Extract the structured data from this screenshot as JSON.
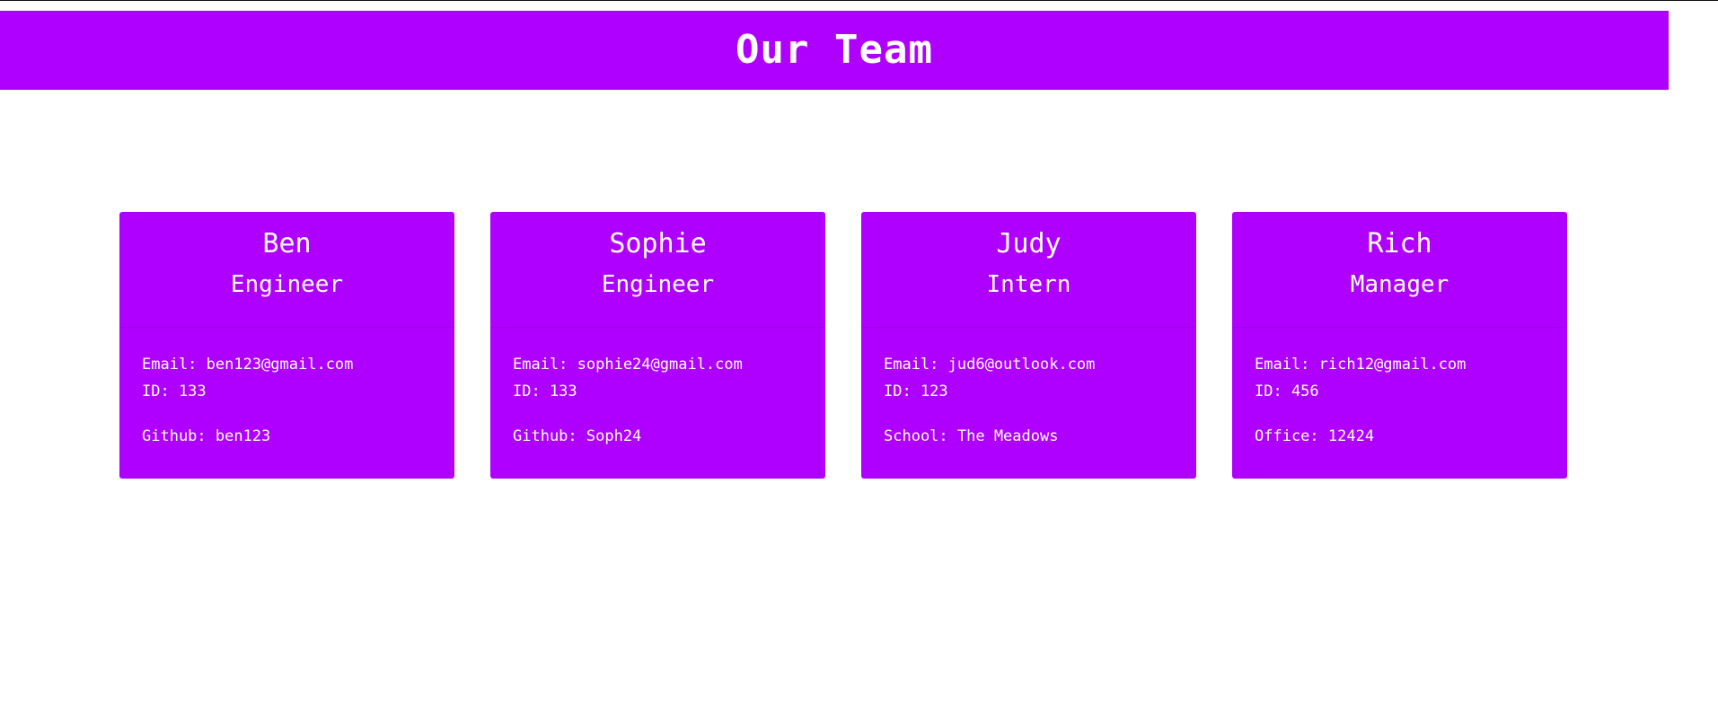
{
  "page": {
    "title": "Our Team"
  },
  "colors": {
    "brand": "#af00ff",
    "text": "#ffffff"
  },
  "team": [
    {
      "name": "Ben",
      "role": "Engineer",
      "email": "Email: ben123@gmail.com",
      "id": "ID: 133",
      "extra": "Github: ben123"
    },
    {
      "name": "Sophie",
      "role": "Engineer",
      "email": "Email: sophie24@gmail.com",
      "id": "ID: 133",
      "extra": "Github: Soph24"
    },
    {
      "name": "Judy",
      "role": "Intern",
      "email": "Email: jud6@outlook.com",
      "id": "ID: 123",
      "extra": "School: The Meadows"
    },
    {
      "name": "Rich",
      "role": "Manager",
      "email": "Email: rich12@gmail.com",
      "id": "ID: 456",
      "extra": "Office: 12424"
    }
  ]
}
